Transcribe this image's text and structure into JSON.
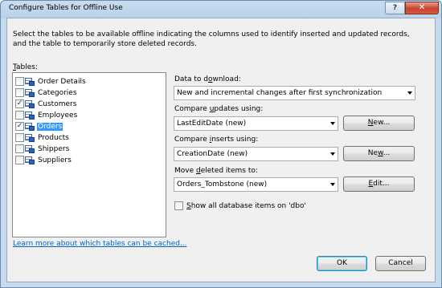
{
  "window": {
    "title": "Configure Tables for Offline Use",
    "help_label": "?",
    "close_label": "✕"
  },
  "intro_text": "Select the tables to be available offline indicating the columns used to identify inserted and updated records, and the table to temporarily store deleted records.",
  "tables": {
    "label_mnemonic": "T",
    "label_rest": "ables:",
    "items": [
      {
        "name": "Order Details",
        "checked": false,
        "selected": false
      },
      {
        "name": "Categories",
        "checked": false,
        "selected": false
      },
      {
        "name": "Customers",
        "checked": true,
        "selected": false
      },
      {
        "name": "Employees",
        "checked": false,
        "selected": false
      },
      {
        "name": "Orders",
        "checked": true,
        "selected": true
      },
      {
        "name": "Products",
        "checked": false,
        "selected": false
      },
      {
        "name": "Shippers",
        "checked": false,
        "selected": false
      },
      {
        "name": "Suppliers",
        "checked": false,
        "selected": false
      }
    ]
  },
  "download": {
    "label_pre": "Data to d",
    "label_mnemonic": "o",
    "label_post": "wnload:",
    "value": "New and incremental changes after first synchronization"
  },
  "updates": {
    "label_pre": "Compare ",
    "label_mnemonic": "u",
    "label_post": "pdates using:",
    "value": "LastEditDate (new)",
    "button_mnemonic": "N",
    "button_post": "ew..."
  },
  "inserts": {
    "label_pre": "Compare ",
    "label_mnemonic": "i",
    "label_post": "nserts using:",
    "value": "CreationDate (new)",
    "button_pre": "Ne",
    "button_mnemonic": "w",
    "button_post": "..."
  },
  "deleted": {
    "label_pre": "Move ",
    "label_mnemonic": "d",
    "label_post": "eleted items to:",
    "value": "Orders_Tombstone (new)",
    "button_mnemonic": "E",
    "button_post": "dit..."
  },
  "show_all": {
    "checked": false,
    "label_mnemonic": "S",
    "label_post": "how all database items on 'dbo'"
  },
  "learn_more": "Learn more about which tables can be cached...",
  "ok_label": "OK",
  "cancel_label": "Cancel"
}
